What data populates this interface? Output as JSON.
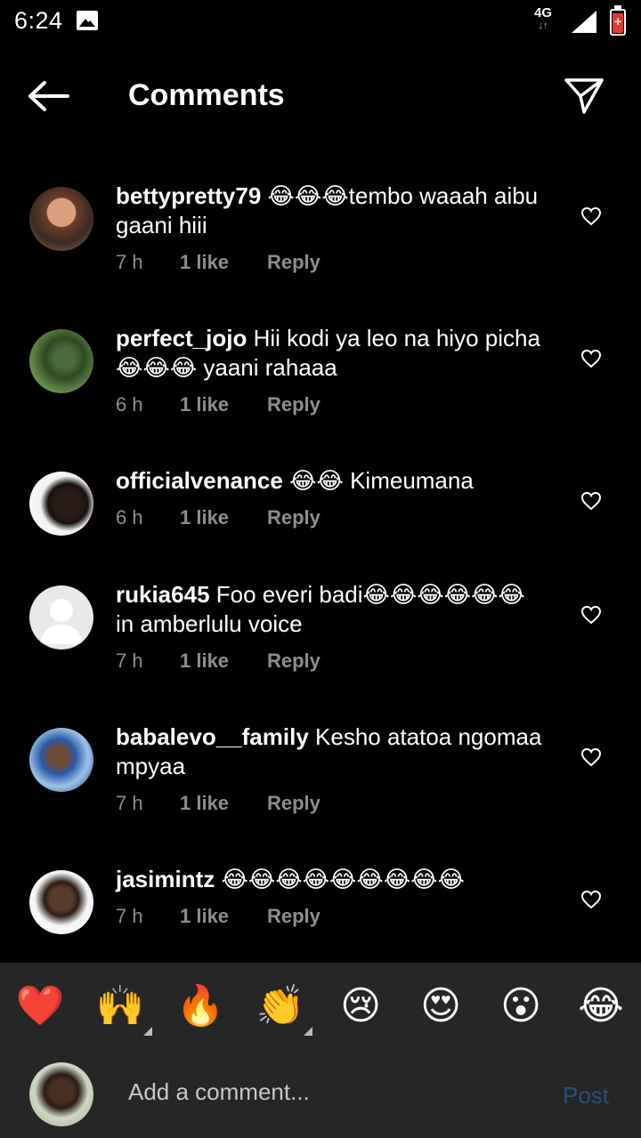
{
  "status_bar": {
    "time": "6:24",
    "network": "4G"
  },
  "header": {
    "title": "Comments"
  },
  "comments": [
    {
      "username": "bettypretty79",
      "text": "😂😂😂tembo waaah aibu gaani hiii",
      "time": "7 h",
      "likes": "1 like",
      "reply": "Reply"
    },
    {
      "username": "perfect_jojo",
      "text": "Hii kodi ya leo na hiyo picha 😂😂😂 yaani rahaaa",
      "time": "6 h",
      "likes": "1 like",
      "reply": "Reply"
    },
    {
      "username": "officialvenance",
      "text": "😂😂 Kimeumana",
      "time": "6 h",
      "likes": "1 like",
      "reply": "Reply"
    },
    {
      "username": "rukia645",
      "text": "Foo everi badi😂😂😂😂😂😂in amberlulu voice",
      "time": "7 h",
      "likes": "1 like",
      "reply": "Reply"
    },
    {
      "username": "babalevo__family",
      "text": "Kesho atatoa ngomaa mpyaa",
      "time": "7 h",
      "likes": "1 like",
      "reply": "Reply"
    },
    {
      "username": "jasimintz",
      "text": "😂😂😂😂😂😂😂😂😂",
      "time": "7 h",
      "likes": "1 like",
      "reply": "Reply"
    }
  ],
  "reactions": [
    "❤️",
    "🙌",
    "🔥",
    "👏",
    "😢",
    "😍",
    "😮",
    "😂"
  ],
  "composer": {
    "placeholder": "Add a comment...",
    "post_label": "Post"
  },
  "colors": {
    "background": "#000000",
    "panel": "#262626",
    "muted_text": "#8e8e8e",
    "post_disabled": "#2a4f79"
  }
}
